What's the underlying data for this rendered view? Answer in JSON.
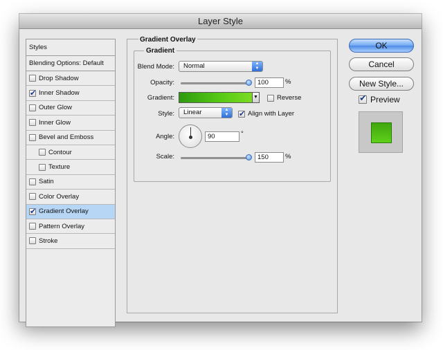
{
  "window": {
    "title": "Layer Style"
  },
  "styles_list": {
    "header": "Styles",
    "blending": "Blending Options: Default",
    "items": [
      {
        "label": "Drop Shadow",
        "checked": false,
        "sub": false
      },
      {
        "label": "Inner Shadow",
        "checked": true,
        "sub": false
      },
      {
        "label": "Outer Glow",
        "checked": false,
        "sub": false
      },
      {
        "label": "Inner Glow",
        "checked": false,
        "sub": false
      },
      {
        "label": "Bevel and Emboss",
        "checked": false,
        "sub": false
      },
      {
        "label": "Contour",
        "checked": false,
        "sub": true
      },
      {
        "label": "Texture",
        "checked": false,
        "sub": true
      },
      {
        "label": "Satin",
        "checked": false,
        "sub": false
      },
      {
        "label": "Color Overlay",
        "checked": false,
        "sub": false
      },
      {
        "label": "Gradient Overlay",
        "checked": true,
        "sub": false,
        "selected": true
      },
      {
        "label": "Pattern Overlay",
        "checked": false,
        "sub": false
      },
      {
        "label": "Stroke",
        "checked": false,
        "sub": false
      }
    ]
  },
  "gradient_overlay": {
    "section_title": "Gradient Overlay",
    "group_title": "Gradient",
    "blend_mode": {
      "label": "Blend Mode:",
      "value": "Normal"
    },
    "opacity": {
      "label": "Opacity:",
      "value": "100",
      "unit": "%"
    },
    "gradient": {
      "label": "Gradient:",
      "reverse_label": "Reverse",
      "reverse_checked": false,
      "colors": [
        "#2f9a10",
        "#7ddb22"
      ]
    },
    "style": {
      "label": "Style:",
      "value": "Linear",
      "align_label": "Align with Layer",
      "align_checked": true
    },
    "angle": {
      "label": "Angle:",
      "value": "90",
      "unit": "°"
    },
    "scale": {
      "label": "Scale:",
      "value": "150",
      "unit": "%"
    }
  },
  "buttons": {
    "ok": "OK",
    "cancel": "Cancel",
    "new_style": "New Style..."
  },
  "preview": {
    "label": "Preview",
    "checked": true,
    "swatch_color": "#4cbf15"
  }
}
